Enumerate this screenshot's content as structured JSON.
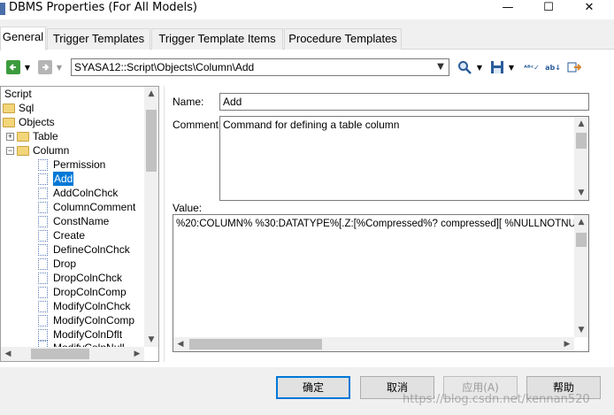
{
  "window": {
    "title": "DBMS Properties (For All Models)",
    "minimize": "—",
    "maximize": "☐",
    "close": "✕"
  },
  "tabs": [
    {
      "label": "General",
      "active": true
    },
    {
      "label": "Trigger Templates",
      "active": false
    },
    {
      "label": "Trigger Template Items",
      "active": false
    },
    {
      "label": "Procedure Templates",
      "active": false
    }
  ],
  "toolbar": {
    "path": "SYASA12::Script\\Objects\\Column\\Add",
    "icons": [
      "back-arrow-icon",
      "forward-arrow-icon",
      "search-icon",
      "save-icon",
      "spell-check-icon",
      "sort-alpha-icon",
      "goto-icon"
    ]
  },
  "tree": {
    "root": "Script",
    "items": [
      {
        "label": "Sql",
        "type": "folder"
      },
      {
        "label": "Objects",
        "type": "folder"
      },
      {
        "label": "Table",
        "type": "folder"
      },
      {
        "label": "Column",
        "type": "folder"
      },
      {
        "label": "Permission",
        "type": "doc"
      },
      {
        "label": "Add",
        "type": "doc",
        "selected": true
      },
      {
        "label": "AddColnChck",
        "type": "doc"
      },
      {
        "label": "ColumnComment",
        "type": "doc"
      },
      {
        "label": "ConstName",
        "type": "doc"
      },
      {
        "label": "Create",
        "type": "doc"
      },
      {
        "label": "DefineColnChck",
        "type": "doc"
      },
      {
        "label": "Drop",
        "type": "doc"
      },
      {
        "label": "DropColnChck",
        "type": "doc"
      },
      {
        "label": "DropColnComp",
        "type": "doc"
      },
      {
        "label": "ModifyColnChck",
        "type": "doc"
      },
      {
        "label": "ModifyColnComp",
        "type": "doc"
      },
      {
        "label": "ModifyColnDflt",
        "type": "doc"
      },
      {
        "label": "ModifyColnNull",
        "type": "doc"
      }
    ]
  },
  "form": {
    "name_label": "Name:",
    "name_value": "Add",
    "comment_label": "Comment:",
    "comment_value": "Command for defining a table column",
    "value_label": "Value:",
    "value_text": "%20:COLUMN% %30:DATATYPE%[.Z:[%Compressed%? compressed][ %NULLNOTNULL%][%I"
  },
  "buttons": {
    "ok": "确定",
    "cancel": "取消",
    "apply": "应用(A)",
    "help": "帮助"
  },
  "watermark": "https://blog.csdn.net/kennan520"
}
